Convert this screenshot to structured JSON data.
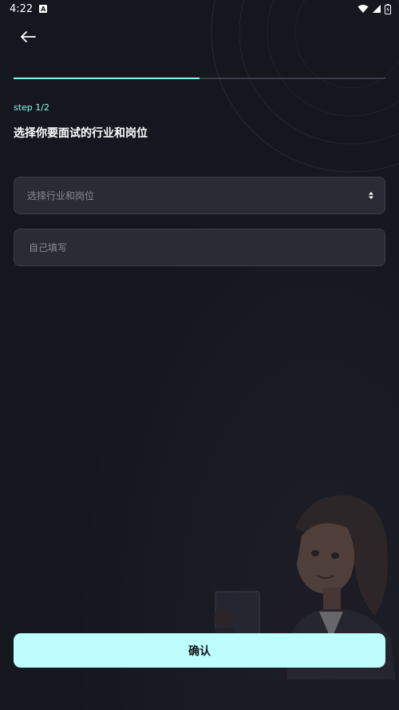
{
  "status_bar": {
    "time": "4:22",
    "notification_badge": "A",
    "icons": [
      "wifi-icon",
      "signal-icon",
      "battery-icon"
    ]
  },
  "header": {
    "back_icon": "arrow-left-icon"
  },
  "progress": {
    "fraction": 0.5
  },
  "step": {
    "label": "step 1/2"
  },
  "title": "选择你要面试的行业和岗位",
  "form": {
    "industry_select": {
      "placeholder": "选择行业和岗位",
      "icon": "sort-arrows-icon"
    },
    "custom_input": {
      "placeholder": "自己填写",
      "value": ""
    }
  },
  "confirm_button": {
    "label": "确认"
  },
  "colors": {
    "background": "#15171f",
    "accent": "#8ff5f0",
    "button_bg": "#bdfdfb",
    "field_bg": "#2a2c35",
    "placeholder": "#868995"
  }
}
